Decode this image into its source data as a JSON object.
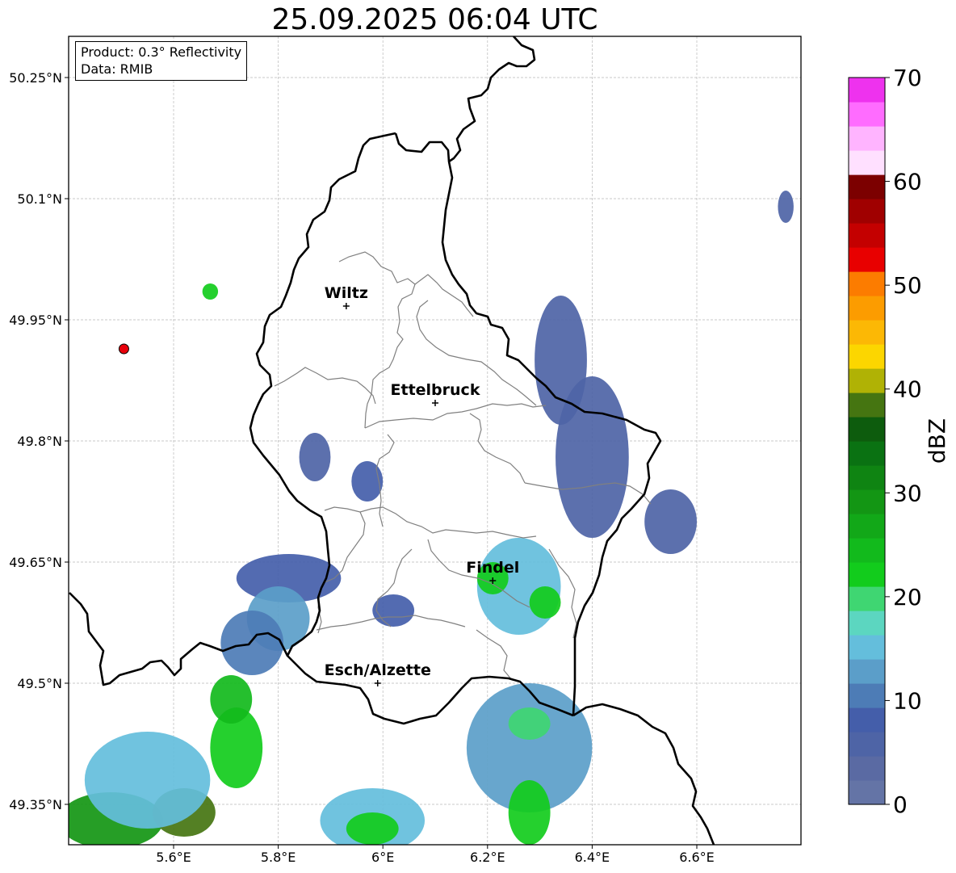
{
  "title": "25.09.2025 06:04 UTC",
  "info": {
    "product": "Product: 0.3° Reflectivity",
    "data_source": "Data: RMIB"
  },
  "axes": {
    "x_ticks": [
      {
        "value": 5.6,
        "label": "5.6°E"
      },
      {
        "value": 5.8,
        "label": "5.8°E"
      },
      {
        "value": 6.0,
        "label": "6°E"
      },
      {
        "value": 6.2,
        "label": "6.2°E"
      },
      {
        "value": 6.4,
        "label": "6.4°E"
      },
      {
        "value": 6.6,
        "label": "6.6°E"
      }
    ],
    "y_ticks": [
      {
        "value": 50.25,
        "label": "50.25°N"
      },
      {
        "value": 50.1,
        "label": "50.1°N"
      },
      {
        "value": 49.95,
        "label": "49.95°N"
      },
      {
        "value": 49.8,
        "label": "49.8°N"
      },
      {
        "value": 49.65,
        "label": "49.65°N"
      },
      {
        "value": 49.5,
        "label": "49.5°N"
      },
      {
        "value": 49.35,
        "label": "49.35°N"
      }
    ],
    "lon_range": [
      5.4,
      6.8
    ],
    "lat_range": [
      49.3,
      50.3
    ],
    "grid": true
  },
  "cities": [
    {
      "name": "Wiltz",
      "lon": 5.93,
      "lat": 49.967
    },
    {
      "name": "Ettelbruck",
      "lon": 6.1,
      "lat": 49.847
    },
    {
      "name": "Findel",
      "lon": 6.21,
      "lat": 49.627
    },
    {
      "name": "Esch/Alzette",
      "lon": 5.99,
      "lat": 49.5
    }
  ],
  "radar_site": {
    "lon": 5.505,
    "lat": 49.914,
    "color": "#e8000b"
  },
  "colorbar": {
    "title": "dBZ",
    "min": 0,
    "max": 70,
    "ticks": [
      "0",
      "10",
      "20",
      "30",
      "40",
      "50",
      "60",
      "70"
    ],
    "colors": [
      "#6474a6",
      "#5a6aa3",
      "#4e64a6",
      "#445eaa",
      "#4d7cb6",
      "#5b9ec9",
      "#64bedc",
      "#5cd6c0",
      "#3fd672",
      "#12cc1c",
      "#12ba1c",
      "#12a818",
      "#139614",
      "#0f8412",
      "#0a7212",
      "#0d5c0d",
      "#457511",
      "#b0b205",
      "#fcd600",
      "#fcb805",
      "#fc9c00",
      "#fc7c00",
      "#e80000",
      "#c40000",
      "#a00000",
      "#7c0000",
      "#ffe0ff",
      "#ffb4ff",
      "#ff6cff",
      "#ee32ee"
    ]
  },
  "precipitation": [
    {
      "lon": 5.48,
      "lat": 49.33,
      "rx": 0.1,
      "ry": 0.035,
      "dbz": 30
    },
    {
      "lon": 5.62,
      "lat": 49.34,
      "rx": 0.06,
      "ry": 0.03,
      "dbz": 38
    },
    {
      "lon": 5.72,
      "lat": 49.42,
      "rx": 0.05,
      "ry": 0.05,
      "dbz": 22
    },
    {
      "lon": 5.71,
      "lat": 49.48,
      "rx": 0.04,
      "ry": 0.03,
      "dbz": 25
    },
    {
      "lon": 5.55,
      "lat": 49.38,
      "rx": 0.12,
      "ry": 0.06,
      "dbz": 15
    },
    {
      "lon": 5.82,
      "lat": 49.63,
      "rx": 0.1,
      "ry": 0.03,
      "dbz": 8
    },
    {
      "lon": 5.98,
      "lat": 49.33,
      "rx": 0.1,
      "ry": 0.04,
      "dbz": 14
    },
    {
      "lon": 5.98,
      "lat": 49.32,
      "rx": 0.05,
      "ry": 0.02,
      "dbz": 22
    },
    {
      "lon": 6.28,
      "lat": 49.42,
      "rx": 0.12,
      "ry": 0.08,
      "dbz": 12
    },
    {
      "lon": 6.28,
      "lat": 49.34,
      "rx": 0.04,
      "ry": 0.04,
      "dbz": 23
    },
    {
      "lon": 6.28,
      "lat": 49.45,
      "rx": 0.04,
      "ry": 0.02,
      "dbz": 20
    },
    {
      "lon": 6.26,
      "lat": 49.62,
      "rx": 0.08,
      "ry": 0.06,
      "dbz": 14
    },
    {
      "lon": 6.31,
      "lat": 49.6,
      "rx": 0.03,
      "ry": 0.02,
      "dbz": 22
    },
    {
      "lon": 6.21,
      "lat": 49.63,
      "rx": 0.03,
      "ry": 0.02,
      "dbz": 22
    },
    {
      "lon": 6.4,
      "lat": 49.78,
      "rx": 0.07,
      "ry": 0.1,
      "dbz": 6
    },
    {
      "lon": 6.34,
      "lat": 49.9,
      "rx": 0.05,
      "ry": 0.08,
      "dbz": 6
    },
    {
      "lon": 6.55,
      "lat": 49.7,
      "rx": 0.05,
      "ry": 0.04,
      "dbz": 5
    },
    {
      "lon": 5.87,
      "lat": 49.78,
      "rx": 0.03,
      "ry": 0.03,
      "dbz": 6
    },
    {
      "lon": 5.97,
      "lat": 49.75,
      "rx": 0.03,
      "ry": 0.025,
      "dbz": 8
    },
    {
      "lon": 6.77,
      "lat": 50.09,
      "rx": 0.015,
      "ry": 0.02,
      "dbz": 5
    },
    {
      "lon": 5.67,
      "lat": 49.985,
      "rx": 0.015,
      "ry": 0.01,
      "dbz": 22
    },
    {
      "lon": 6.02,
      "lat": 49.59,
      "rx": 0.04,
      "ry": 0.02,
      "dbz": 7
    },
    {
      "lon": 5.8,
      "lat": 49.58,
      "rx": 0.06,
      "ry": 0.04,
      "dbz": 12
    },
    {
      "lon": 5.75,
      "lat": 49.55,
      "rx": 0.06,
      "ry": 0.04,
      "dbz": 10
    }
  ]
}
